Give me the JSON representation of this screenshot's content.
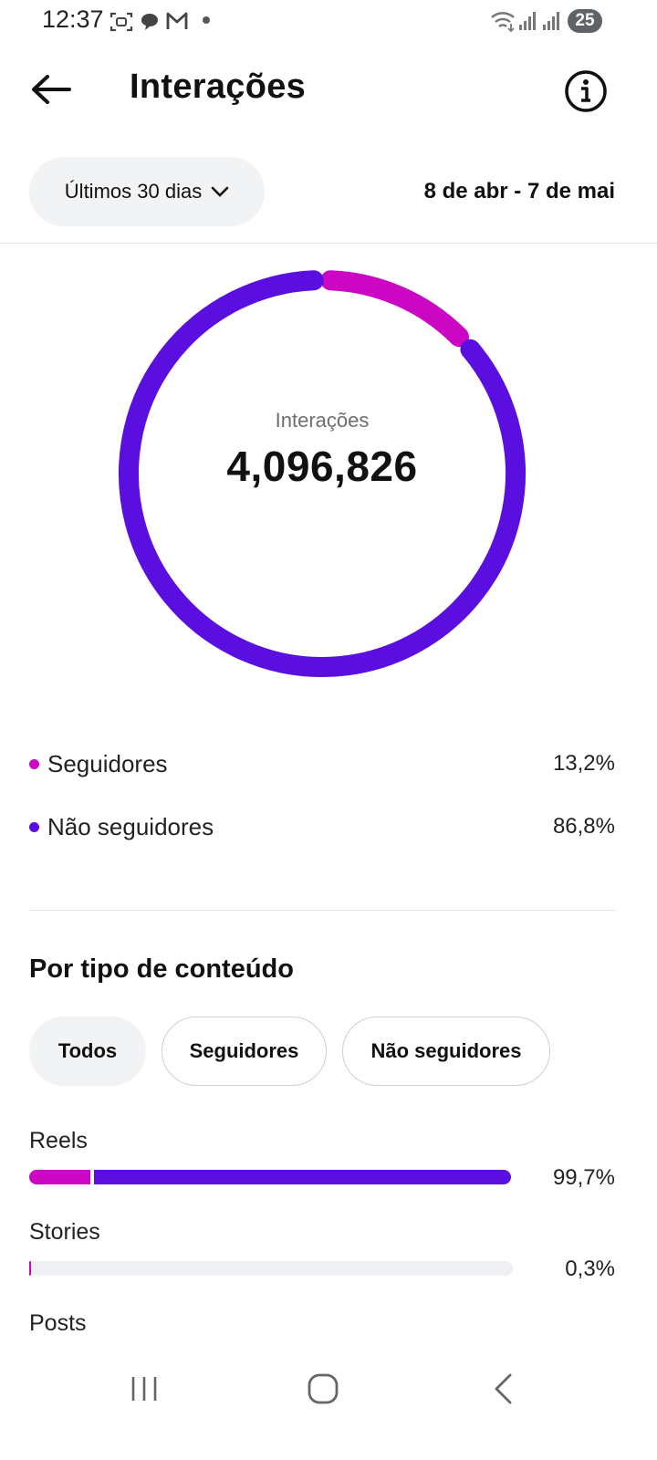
{
  "status_bar": {
    "time": "12:37",
    "battery": "25",
    "icons": [
      "screenshot-icon",
      "chat-bubble-icon",
      "gmail-icon",
      "dot-icon",
      "wifi-icon",
      "signal-icon",
      "signal-icon"
    ]
  },
  "header": {
    "title": "Interações",
    "back_icon": "arrow-left-icon",
    "info_icon": "info-icon"
  },
  "period": {
    "selected": "Últimos 30 dias",
    "date_range": "8 de abr - 7 de mai"
  },
  "summary": {
    "label": "Interações",
    "value": "4,096,826"
  },
  "audience": [
    {
      "name": "Seguidores",
      "percent": "13,2%",
      "fraction": 0.132,
      "color": "#cc07c4"
    },
    {
      "name": "Não seguidores",
      "percent": "86,8%",
      "fraction": 0.868,
      "color": "#5a0fe0"
    }
  ],
  "content_section": {
    "title": "Por tipo de conteúdo",
    "filters": [
      "Todos",
      "Seguidores",
      "Não seguidores"
    ],
    "selected_filter": "Todos",
    "rows": [
      {
        "label": "Reels",
        "percent": "99,7%",
        "fraction": 0.997,
        "followers_fraction": 0.13
      },
      {
        "label": "Stories",
        "percent": "0,3%",
        "fraction": 0.003,
        "followers_fraction": 1.0
      },
      {
        "label": "Posts",
        "percent": "",
        "fraction": null,
        "followers_fraction": null
      }
    ]
  },
  "colors": {
    "followers": "#cc07c4",
    "non_followers": "#5a0fe0",
    "track": "#eff0f3"
  },
  "nav_bar": {
    "icons": [
      "recent-apps-icon",
      "home-icon",
      "back-icon"
    ]
  }
}
